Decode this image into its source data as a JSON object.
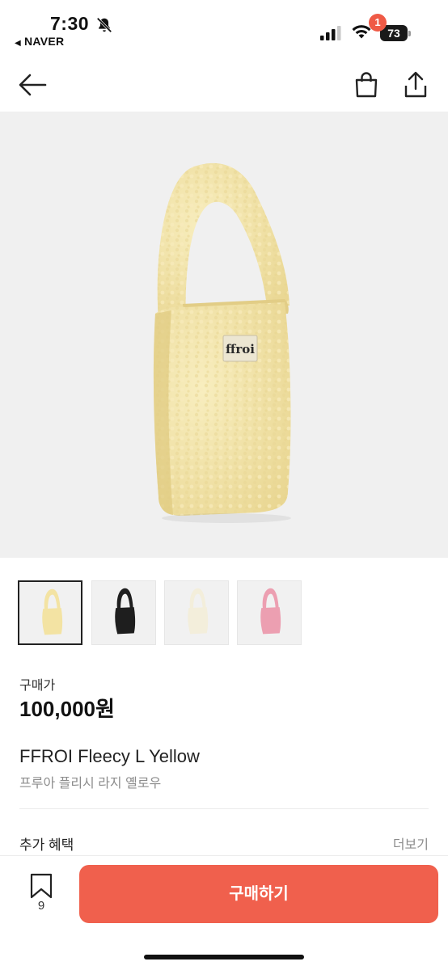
{
  "status_bar": {
    "time": "7:30",
    "back_app": "NAVER",
    "battery": "73"
  },
  "nav": {
    "cart_count": "1",
    "icons": [
      "back-arrow-icon",
      "shopping-bag-icon",
      "share-icon"
    ]
  },
  "product": {
    "price_label": "구매가",
    "price": "100,000원",
    "title_en": "FFROI Fleecy L Yellow",
    "title_ko": "프루아 플리시 라지 옐로우",
    "brand_label": "ffroi",
    "thumbnails": [
      {
        "color": "yellow",
        "fill": "#f3e3a3",
        "selected": true
      },
      {
        "color": "black",
        "fill": "#1e1e1e",
        "selected": false
      },
      {
        "color": "cream",
        "fill": "#f1ecd8",
        "selected": false
      },
      {
        "color": "pink",
        "fill": "#ec9fb1",
        "selected": false
      }
    ]
  },
  "benefits": {
    "label": "추가 혜택",
    "more": "더보기"
  },
  "bottom_bar": {
    "bookmark_count": "9",
    "buy_label": "구매하기"
  },
  "colors": {
    "accent": "#f0604d",
    "badge": "#ef5a46",
    "hero_bg": "#f0f0f0"
  }
}
